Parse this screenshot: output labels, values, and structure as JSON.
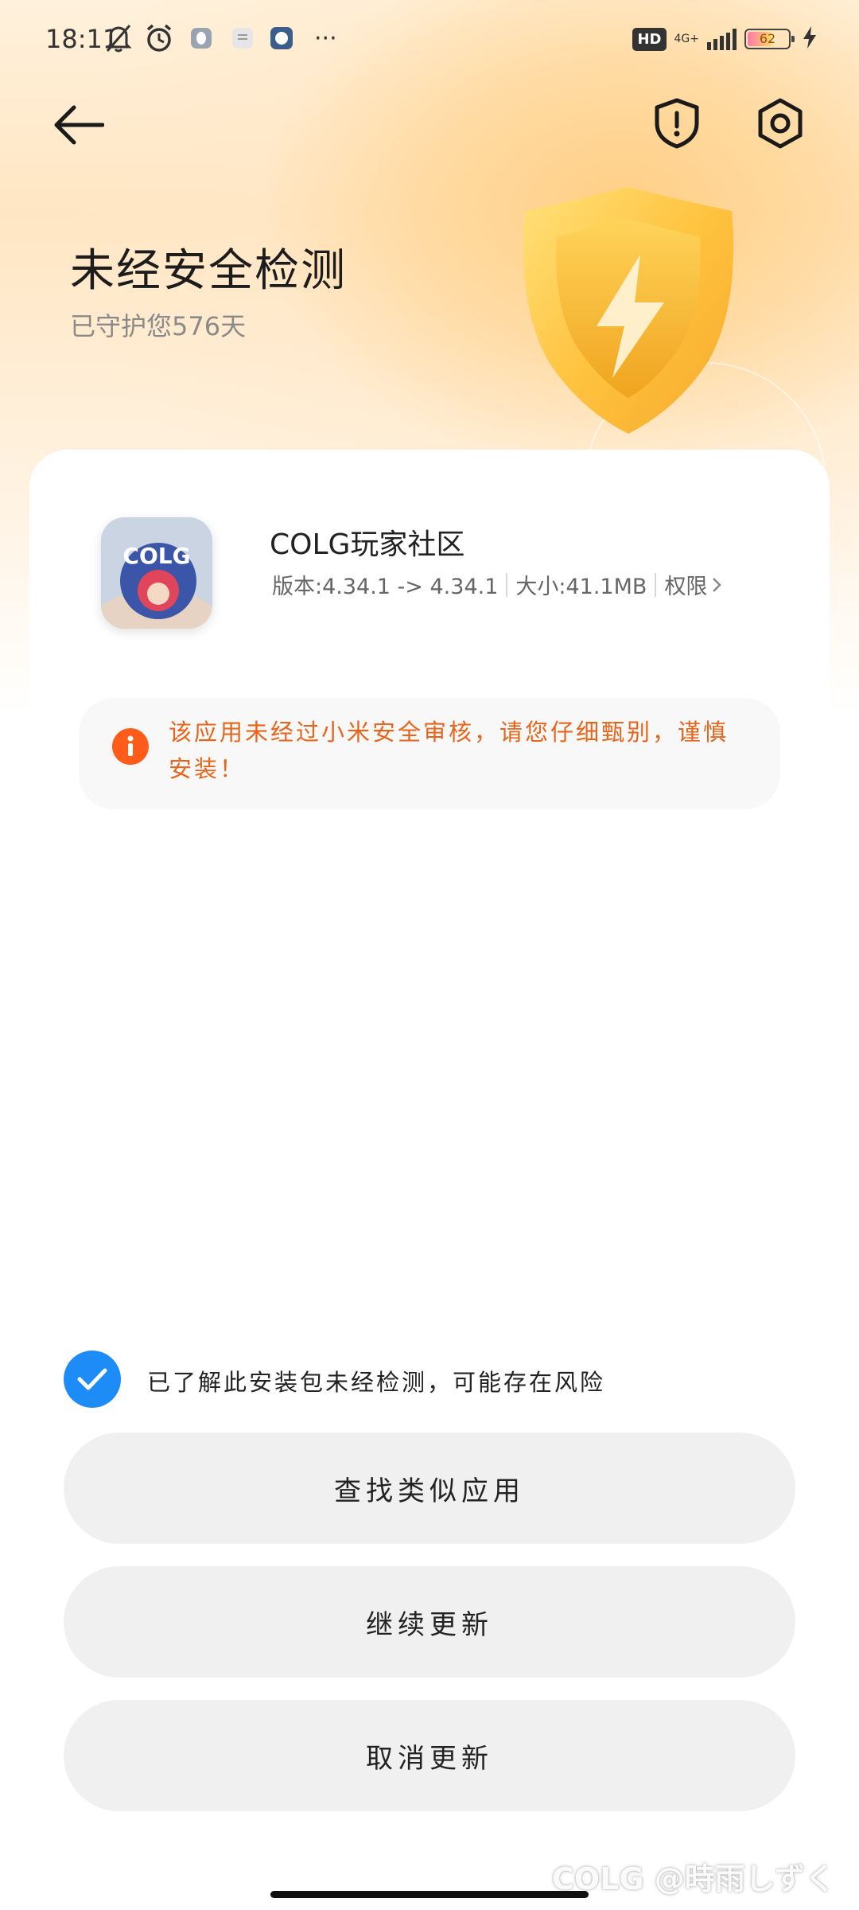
{
  "status_bar": {
    "time": "18:11",
    "hd_badge": "HD",
    "network": "4G+",
    "battery_level": "62",
    "more": "···"
  },
  "header": {
    "back_icon": "arrow-left-icon",
    "security_icon": "shield-alert-icon",
    "settings_icon": "gear-icon"
  },
  "hero": {
    "title": "未经安全检测",
    "subtitle": "已守护您576天"
  },
  "app": {
    "name": "COLG玩家社区",
    "icon_text": "COLG",
    "version": "版本:4.34.1 -> 4.34.1",
    "size": "大小:41.1MB",
    "permissions_label": "权限"
  },
  "warning": {
    "text": "该应用未经过小米安全审核，请您仔细甄别，谨慎安装！",
    "color": "#e96419"
  },
  "acknowledge": {
    "checked": true,
    "text": "已了解此安装包未经检测，可能存在风险"
  },
  "actions": {
    "find_similar": "查找类似应用",
    "continue_update": "继续更新",
    "cancel_update": "取消更新"
  },
  "watermark": "COLG @時雨しずく",
  "colors": {
    "accent_blue": "#1e8cf7",
    "warning_orange": "#ff5c19",
    "button_bg": "#f0f0f0"
  }
}
